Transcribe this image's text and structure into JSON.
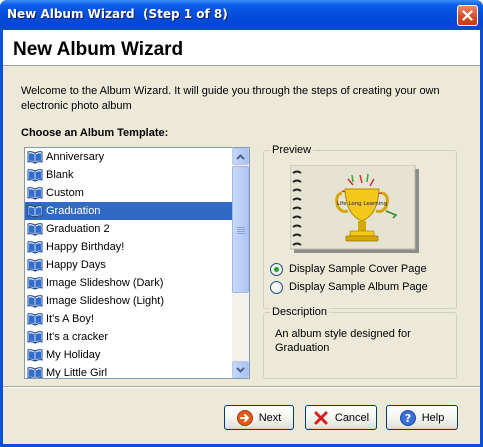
{
  "window": {
    "title": "New Album Wizard  (Step 1 of 8)"
  },
  "header": {
    "title": "New Album Wizard"
  },
  "intro": {
    "text": "Welcome to the Album Wizard.  It will guide you through the steps of creating your own electronic photo album"
  },
  "templates": {
    "label": "Choose an Album Template:",
    "items": [
      {
        "label": "Anniversary",
        "selected": false
      },
      {
        "label": "Blank",
        "selected": false
      },
      {
        "label": "Custom",
        "selected": false
      },
      {
        "label": "Graduation",
        "selected": true
      },
      {
        "label": "Graduation 2",
        "selected": false
      },
      {
        "label": "Happy Birthday!",
        "selected": false
      },
      {
        "label": "Happy Days",
        "selected": false
      },
      {
        "label": "Image Slideshow (Dark)",
        "selected": false
      },
      {
        "label": "Image Slideshow (Light)",
        "selected": false
      },
      {
        "label": "It's A Boy!",
        "selected": false
      },
      {
        "label": "It's a cracker",
        "selected": false
      },
      {
        "label": "My Holiday",
        "selected": false
      },
      {
        "label": "My Little Girl",
        "selected": false
      }
    ]
  },
  "preview": {
    "legend": "Preview",
    "image_text": "Life Long Learning",
    "options": [
      {
        "label": "Display Sample Cover Page",
        "checked": true
      },
      {
        "label": "Display Sample Album Page",
        "checked": false
      }
    ]
  },
  "description": {
    "legend": "Description",
    "text": "An album style designed for Graduation"
  },
  "buttons": {
    "next": "Next",
    "cancel": "Cancel",
    "help": "Help"
  },
  "colors": {
    "titlebar": "#0550de",
    "selection": "#316ac5",
    "dialog_bg": "#ece9d8"
  }
}
